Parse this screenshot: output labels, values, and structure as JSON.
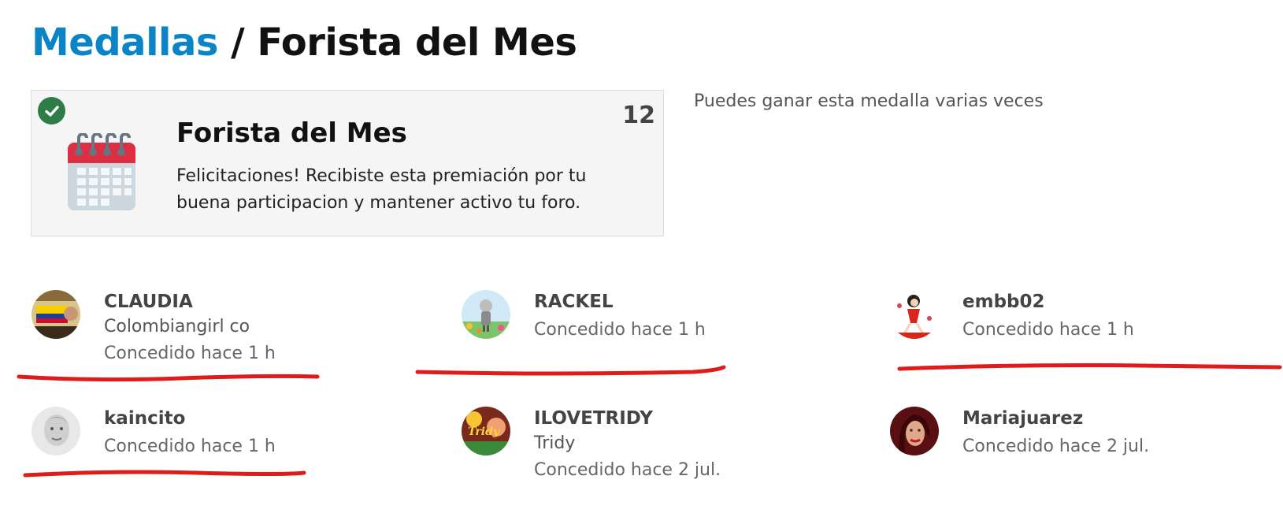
{
  "header": {
    "breadcrumb_link": "Medallas",
    "separator": "/",
    "title": "Forista del Mes"
  },
  "medal": {
    "name": "Forista del Mes",
    "description": "Felicitaciones! Recibiste esta premiación por tu buena participacion y mantener activo tu foro.",
    "count": "12",
    "icon": "calendar-icon",
    "earned_icon": "check-icon",
    "repeat_note": "Puedes ganar esta medalla varias veces"
  },
  "recipients": [
    {
      "username": "CLAUDIA",
      "title": "Colombiangirl co",
      "granted": "Concedido hace 1 h"
    },
    {
      "username": "RACKEL",
      "title": "",
      "granted": "Concedido hace 1 h"
    },
    {
      "username": "embb02",
      "title": "",
      "granted": "Concedido hace 1 h"
    },
    {
      "username": "kaincito",
      "title": "",
      "granted": "Concedido hace 1 h"
    },
    {
      "username": "ILOVETRIDY",
      "title": "Tridy",
      "granted": "Concedido hace 2 jul."
    },
    {
      "username": "Mariajuarez",
      "title": "",
      "granted": "Concedido hace 2 jul."
    }
  ],
  "colors": {
    "link": "#0a84c6",
    "badge_green": "#2f7d46",
    "annotation_red": "#e01b1b"
  }
}
